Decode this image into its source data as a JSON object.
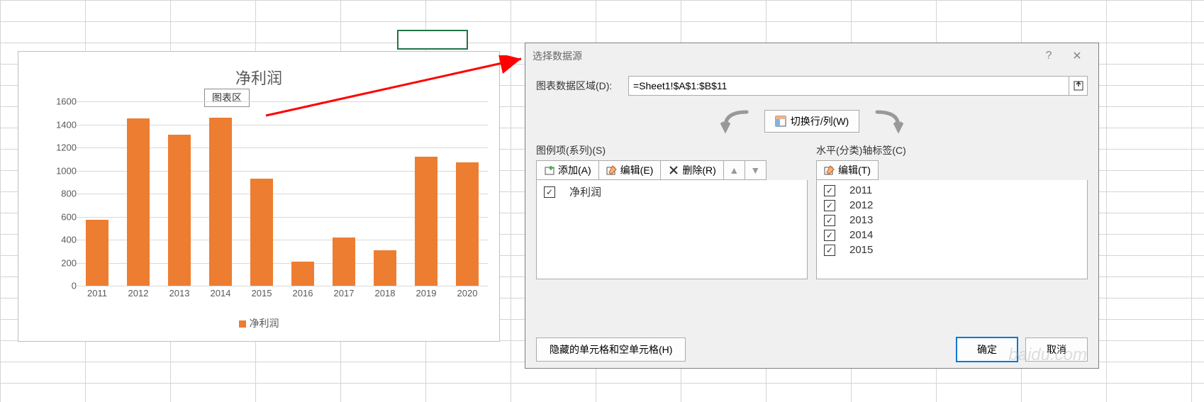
{
  "chart_data": {
    "type": "bar",
    "title": "净利润",
    "categories": [
      "2011",
      "2012",
      "2013",
      "2014",
      "2015",
      "2016",
      "2017",
      "2018",
      "2019",
      "2020"
    ],
    "values": [
      570,
      1450,
      1310,
      1460,
      930,
      210,
      420,
      310,
      1120,
      1070
    ],
    "ylabel": "",
    "xlabel": "",
    "ylim": [
      0,
      1600
    ],
    "yticks": [
      0,
      200,
      400,
      600,
      800,
      1000,
      1200,
      1400,
      1600
    ],
    "series_name": "净利润",
    "color": "#ed7d31"
  },
  "chart_area_label": "图表区",
  "legend_label": "净利润",
  "dialog": {
    "title": "选择数据源",
    "data_range_label": "图表数据区域(D):",
    "data_range_value": "=Sheet1!$A$1:$B$11",
    "switch_btn": "切换行/列(W)",
    "legend_panel_title": "图例项(系列)(S)",
    "axis_panel_title": "水平(分类)轴标签(C)",
    "add_btn": "添加(A)",
    "edit_btn": "编辑(E)",
    "remove_btn": "删除(R)",
    "edit_btn2": "编辑(T)",
    "series_items": [
      "净利润"
    ],
    "category_items": [
      "2011",
      "2012",
      "2013",
      "2014",
      "2015"
    ],
    "hidden_cells_btn": "隐藏的单元格和空单元格(H)",
    "ok_btn": "确定",
    "cancel_btn": "取消"
  },
  "watermark": "baidu.com"
}
